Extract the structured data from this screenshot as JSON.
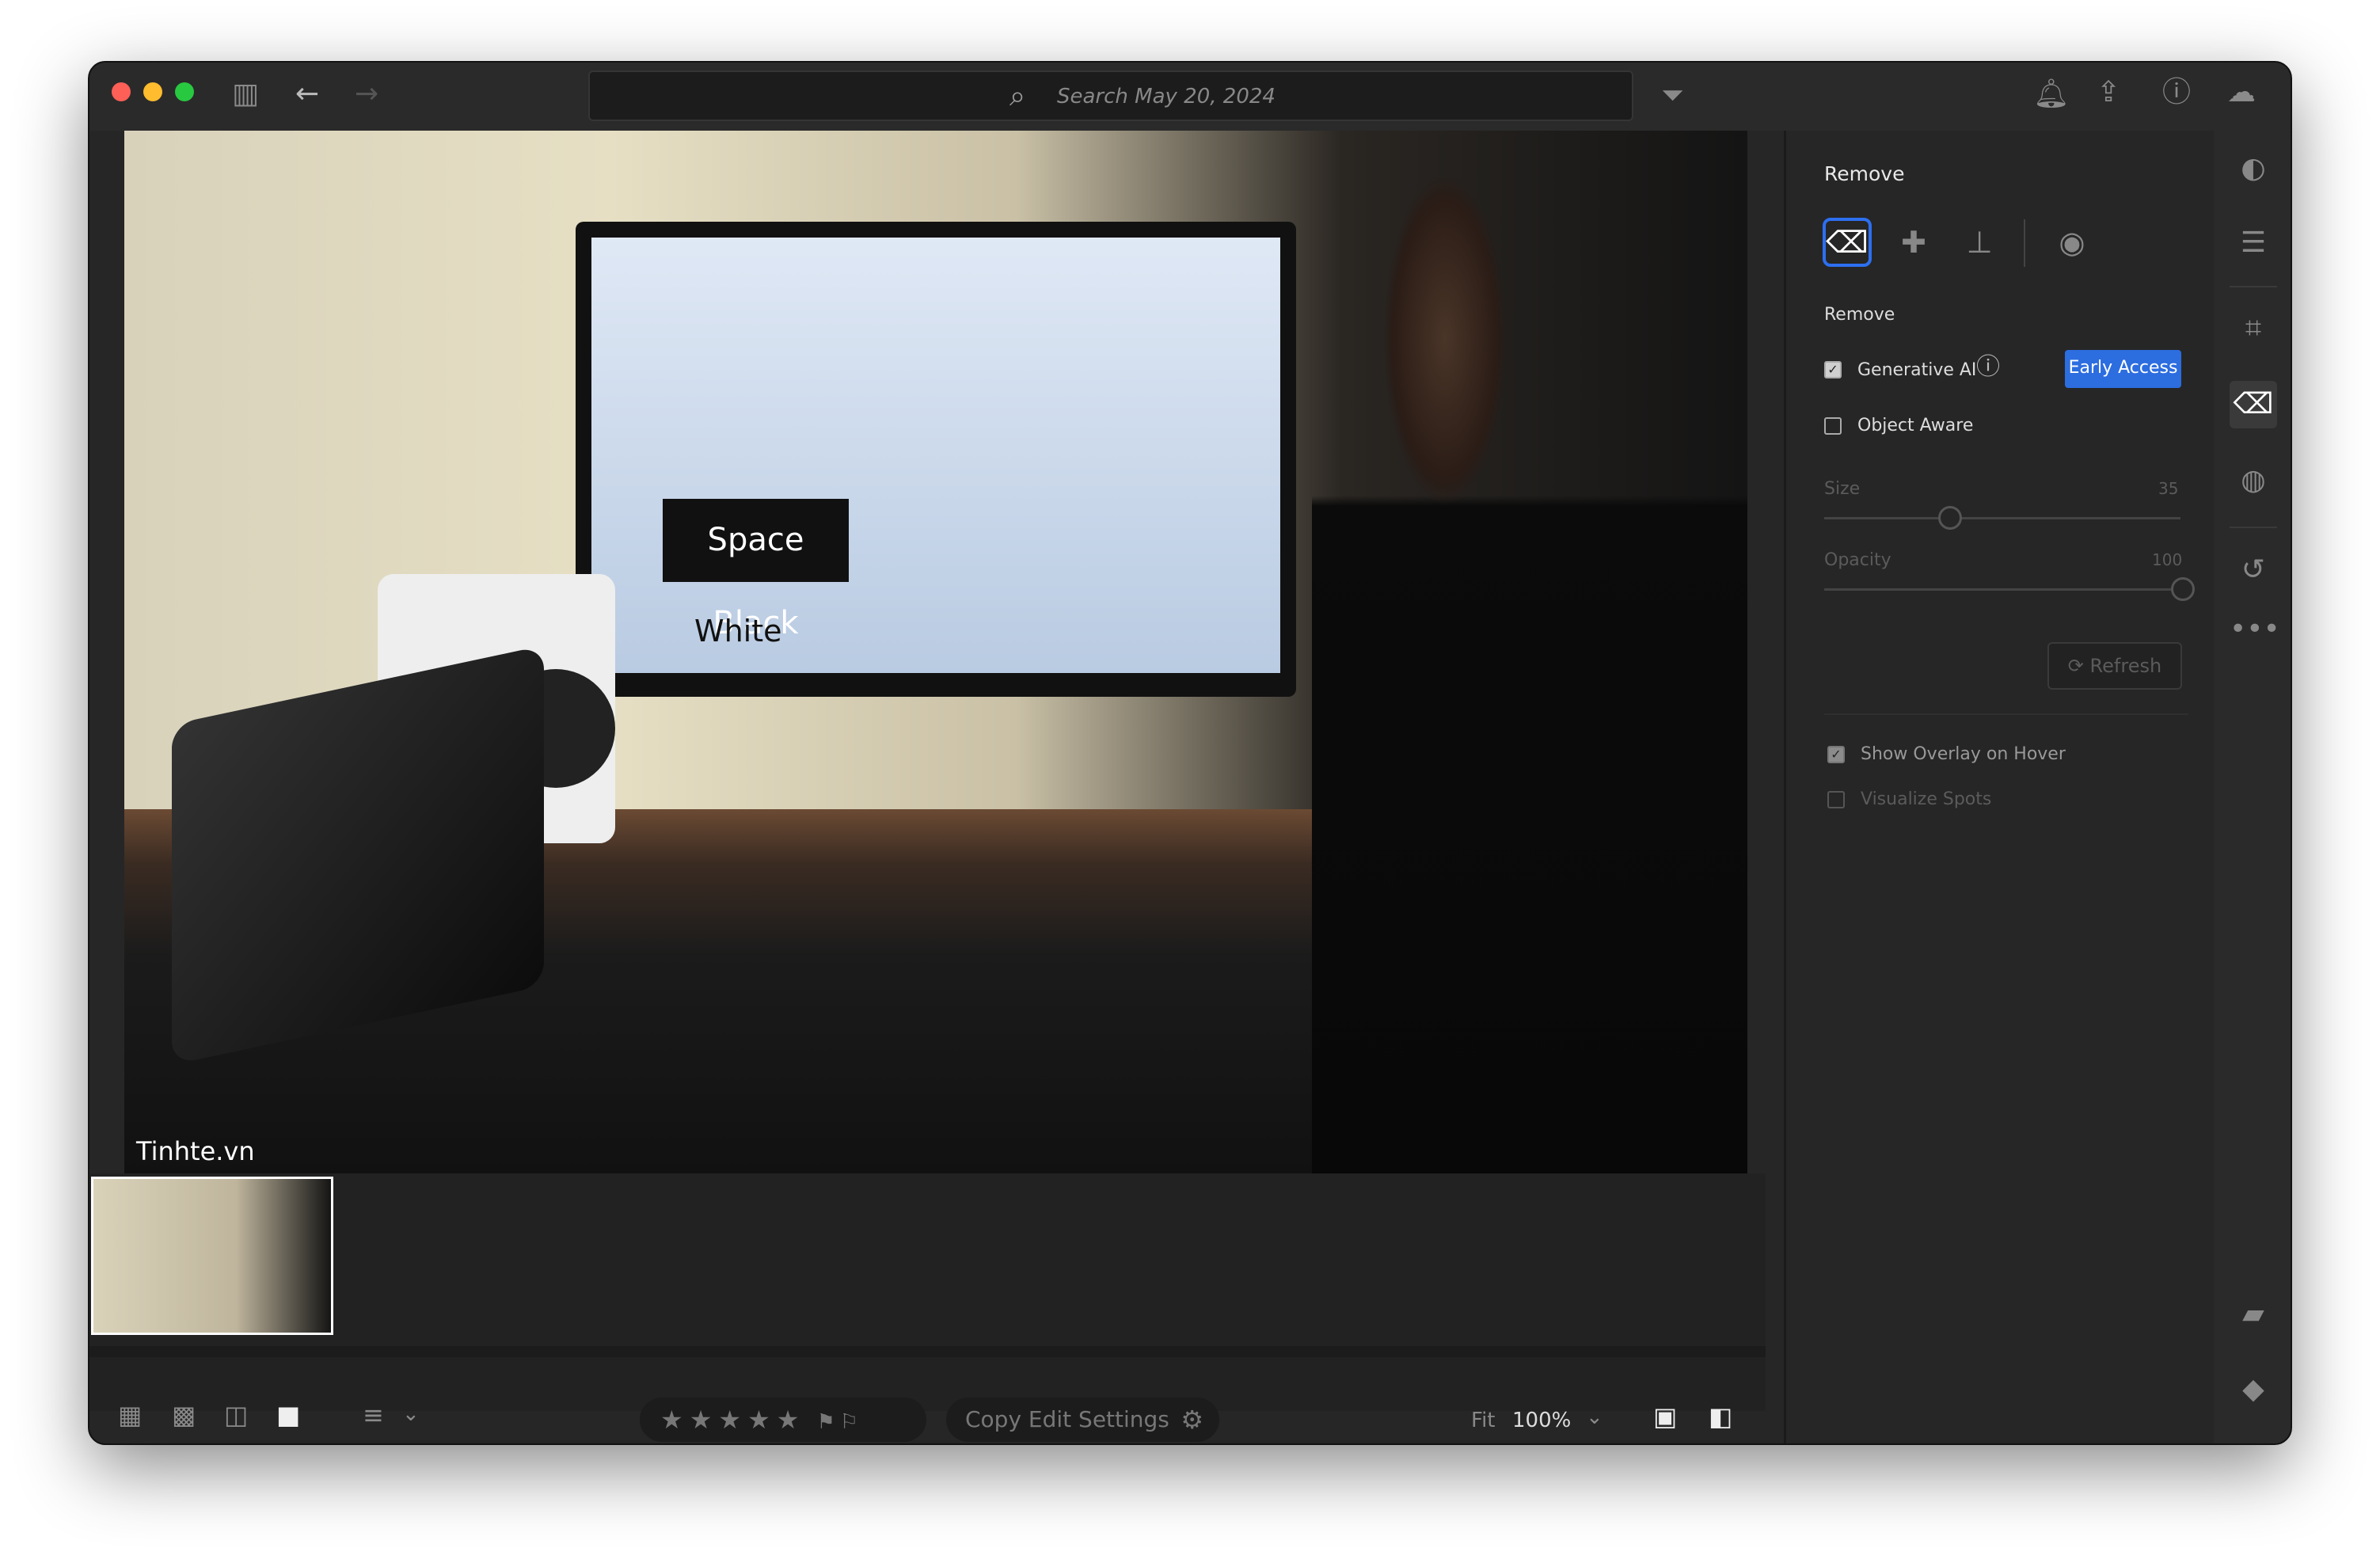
{
  "titlebar": {
    "search_placeholder": "Search May 20, 2024",
    "icons": [
      "sidebar-toggle-icon",
      "back-arrow-icon",
      "forward-arrow-icon",
      "search-icon",
      "filter-icon",
      "bell-icon",
      "share-icon",
      "help-icon",
      "cloud-sync-icon"
    ]
  },
  "photo": {
    "watermark": "Tinhte.vn",
    "screen_text_1": "Space Black",
    "screen_text_2": "White"
  },
  "bottombar": {
    "copy_edit_settings": "Copy Edit Settings",
    "fit_label": "Fit",
    "zoom_value": "100%",
    "rating_stars": 0
  },
  "panel": {
    "title": "Remove",
    "section_label": "Remove",
    "generative_ai_label": "Generative AI",
    "generative_ai_checked": true,
    "early_access_label": "Early Access",
    "object_aware_label": "Object Aware",
    "object_aware_checked": false,
    "size_label": "Size",
    "size_value": "35",
    "opacity_label": "Opacity",
    "opacity_value": "100",
    "refresh_label": "Refresh",
    "show_overlay_label": "Show Overlay on Hover",
    "show_overlay_checked": true,
    "visualize_spots_label": "Visualize Spots",
    "visualize_spots_checked": false
  },
  "colors": {
    "accent": "#2c6de0",
    "background": "#262626"
  }
}
